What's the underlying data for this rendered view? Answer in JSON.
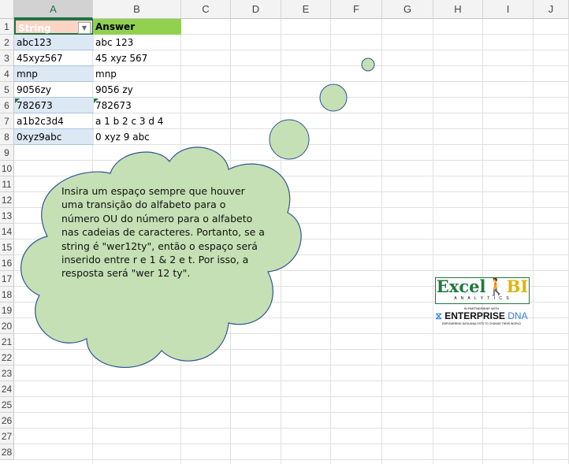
{
  "columns": [
    "A",
    "B",
    "C",
    "D",
    "E",
    "F",
    "G",
    "H",
    "I",
    "J"
  ],
  "rows": [
    "1",
    "2",
    "3",
    "4",
    "5",
    "6",
    "7",
    "8",
    "9",
    "10",
    "11",
    "12",
    "13",
    "14",
    "15",
    "16",
    "17",
    "18",
    "19",
    "20",
    "21",
    "22",
    "23",
    "24",
    "25",
    "26",
    "27",
    "28"
  ],
  "table": {
    "headers": [
      "String",
      "Answer"
    ],
    "string": [
      "abc123",
      "45xyz567",
      "mnp",
      "9056zy",
      "782673",
      "a1b2c3d4",
      "0xyz9abc"
    ],
    "answer": [
      "abc 123",
      "45 xyz 567",
      "mnp",
      "9056 zy",
      "782673",
      "a 1 b 2 c 3 d 4",
      "0 xyz 9 abc"
    ]
  },
  "callout": {
    "text": "Insira um espaço sempre que houver uma transição do alfabeto para o número OU do número para o alfabeto nas cadeias de caracteres. Portanto, se a string é \"wer12ty\", então o espaço será inserido entre r e 1 & 2 e t. Por isso, a resposta será \"wer 12 ty\".",
    "fill": "#c5e0b4"
  },
  "logo": {
    "excel": "Excel",
    "bi": "BI",
    "analytics": "A N A L Y T I C S",
    "partnership": "IN PARTNERSHIP WITH",
    "enterprise": "ENTERPRISE",
    "dna": "DNA",
    "tagline": "EMPOWERING DATA ANALYSTS TO CHANGE THEIR WORLD"
  },
  "colors": {
    "header_a": "#fbd4c4",
    "header_b": "#92d050",
    "band": "#dde8f5",
    "excel_green": "#1e7a3c",
    "bi_gold": "#e0b400"
  }
}
